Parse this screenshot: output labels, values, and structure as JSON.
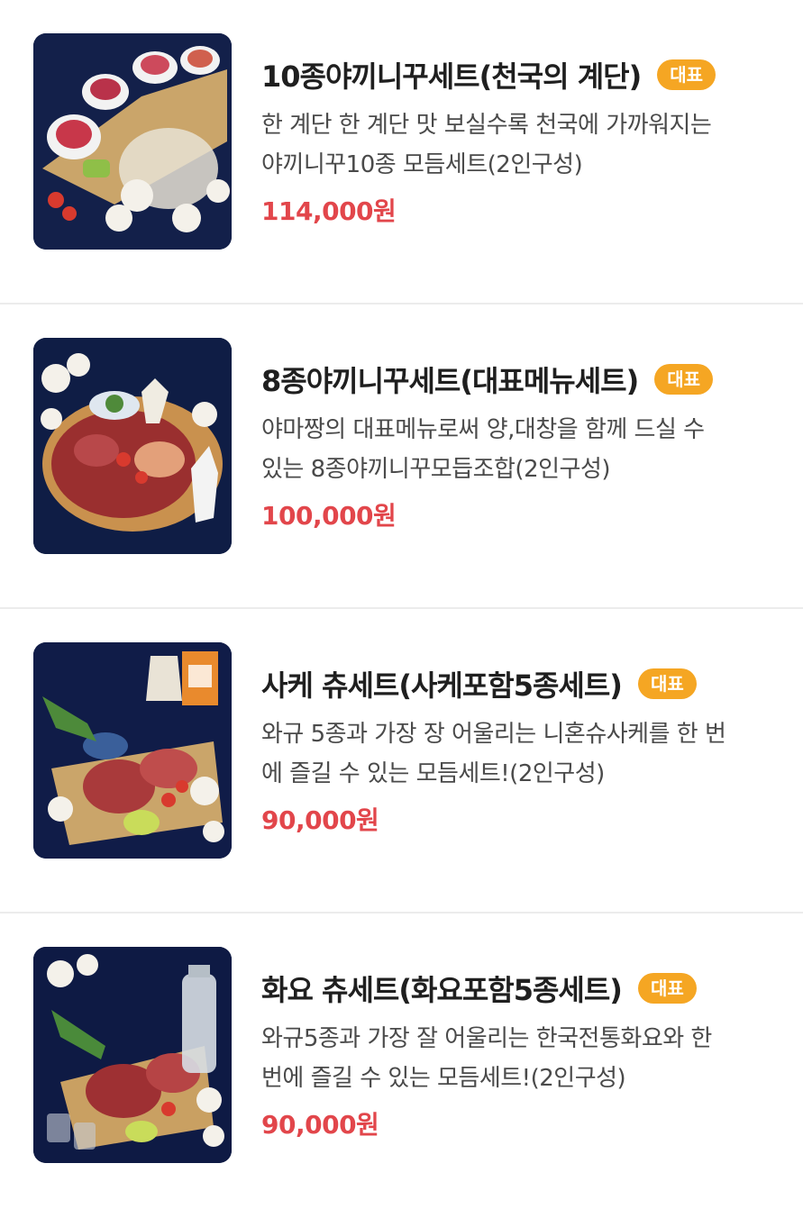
{
  "items": [
    {
      "title": "10종야끼니꾸세트(천국의 계단)",
      "badge": "대표",
      "desc_line1": "한 계단 한 계단 맛 보실수록 천국에 가까워지는",
      "desc_line2": "야끼니꾸10종 모듬세트(2인구성)",
      "price": "114,000원",
      "image_icon": "food-photo"
    },
    {
      "title": "8종야끼니꾸세트(대표메뉴세트)",
      "badge": "대표",
      "desc_line1": "야마짱의 대표메뉴로써 양,대창을 함께 드실 수",
      "desc_line2": "있는 8종야끼니꾸모듭조합(2인구성)",
      "price": "100,000원",
      "image_icon": "food-photo"
    },
    {
      "title": "사케 츄세트(사케포함5종세트)",
      "badge": "대표",
      "desc_line1": "와규 5종과 가장 장 어울리는 니혼슈사케를 한 번",
      "desc_line2": "에 즐길 수 있는 모듬세트!(2인구성)",
      "price": "90,000원",
      "image_icon": "food-photo"
    },
    {
      "title": "화요 츄세트(화요포함5종세트)",
      "badge": "대표",
      "desc_line1": "와규5종과 가장 잘 어울리는 한국전통화요와 한",
      "desc_line2": "번에 즐길 수 있는 모듬세트!(2인구성)",
      "price": "90,000원",
      "image_icon": "food-photo"
    }
  ],
  "colors": {
    "badge": "#f5a623",
    "price": "#e2464b",
    "divider": "#ececec",
    "thumb_bg": "#0f1b3c"
  }
}
